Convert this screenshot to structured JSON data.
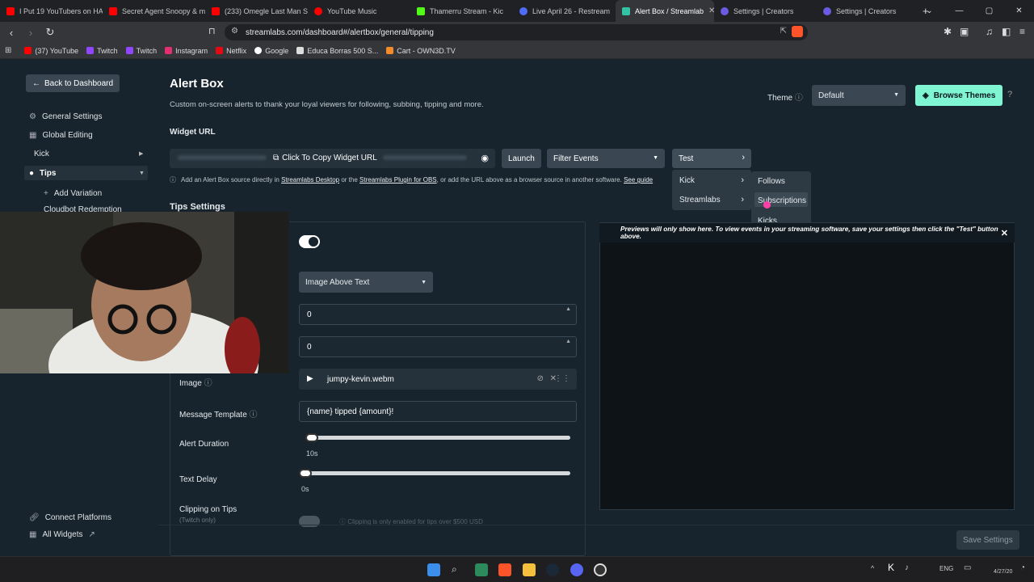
{
  "browser": {
    "tabs": [
      {
        "title": "I Put 19 YouTubers on HA",
        "color": "#ff0000"
      },
      {
        "title": "Secret Agent Snoopy & m",
        "color": "#ff0000"
      },
      {
        "title": "(233) Omegle Last Man St",
        "color": "#ff0000"
      },
      {
        "title": "YouTube Music",
        "color": "#ff0000"
      },
      {
        "title": "Thamerru Stream - Kic",
        "color": "#53fc18"
      },
      {
        "title": "Live April 26 - Restream",
        "color": "#4f6cf7"
      },
      {
        "title": "Alert Box / Streamlab",
        "color": "#31c3a2",
        "active": true
      },
      {
        "title": "Settings | Creators",
        "color": "#6a5be2"
      },
      {
        "title": "Settings | Creators",
        "color": "#6a5be2"
      }
    ],
    "new_tab": "+",
    "url": "streamlabs.com/dashboard#/alertbox/general/tipping",
    "bookmarks": [
      {
        "label": "(37) YouTube",
        "color": "#ff0000"
      },
      {
        "label": "Twitch",
        "color": "#9146ff"
      },
      {
        "label": "Twitch",
        "color": "#9146ff"
      },
      {
        "label": "Instagram",
        "color": "#e1306c"
      },
      {
        "label": "Netflix",
        "color": "#e50914"
      },
      {
        "label": "Google",
        "color": "#ffffff"
      },
      {
        "label": "Educa Borras 500 S...",
        "color": "#dddddd"
      },
      {
        "label": "Cart - OWN3D.TV",
        "color": "#f28c28"
      }
    ]
  },
  "sidebar": {
    "back_label": "Back to Dashboard",
    "items": [
      {
        "label": "General Settings",
        "icon": "gear-icon"
      },
      {
        "label": "Global Editing",
        "icon": "grid-icon"
      },
      {
        "label": "Kick",
        "icon": ""
      },
      {
        "label": "Tips",
        "icon": "tips-icon"
      },
      {
        "label": "Add Variation",
        "icon": "plus-icon"
      },
      {
        "label": "Cloudbot Redemption",
        "icon": ""
      }
    ],
    "footer": [
      {
        "label": "Connect Platforms",
        "icon": "link-icon"
      },
      {
        "label": "All Widgets",
        "icon": "grid-icon"
      }
    ]
  },
  "header": {
    "title": "Alert Box",
    "subtitle": "Custom on-screen alerts to thank your loyal viewers for following, subbing, tipping and more.",
    "theme_label": "Theme",
    "theme_value": "Default",
    "browse_label": "Browse Themes",
    "accent": "#80f5d2"
  },
  "widget": {
    "url_label": "Widget URL",
    "copy_label": "Click To Copy Widget URL",
    "launch_label": "Launch",
    "filter_label": "Filter Events",
    "test_label": "Test",
    "hint_prefix": "Add an Alert Box source directly in",
    "hint_link1": "Streamlabs Desktop",
    "hint_mid": "or the",
    "hint_link2": "Streamlabs Plugin for OBS",
    "hint_suffix": ", or add the URL above as a browser source in another software.",
    "hint_link3": "See guide"
  },
  "test_menu": {
    "level1": [
      "Kick",
      "Streamlabs"
    ],
    "level2": [
      "Follows",
      "Subscriptions",
      "Kicks"
    ]
  },
  "tips": {
    "section_title": "Tips Settings",
    "layout_value": "Image Above Text",
    "number1": "0",
    "number2": "0",
    "image_label": "Image",
    "image_file": "jumpy-kevin.webm",
    "message_label": "Message Template",
    "message_value": "{name} tipped {amount}!",
    "duration_label": "Alert Duration",
    "duration_value": "10s",
    "delay_label": "Text Delay",
    "delay_value": "0s",
    "clipping_label": "Clipping on Tips",
    "clipping_sub": "(Twitch only)",
    "clipping_note": "Clipping is only enabled for tips over $500 USD"
  },
  "preview": {
    "notice": "Previews will only show here. To view events in your streaming software, save your settings then click the \"Test\" button above."
  },
  "footer": {
    "save_label": "Save Settings"
  },
  "taskbar": {
    "lang": "ENG",
    "time": "",
    "date": "4/27/20"
  }
}
